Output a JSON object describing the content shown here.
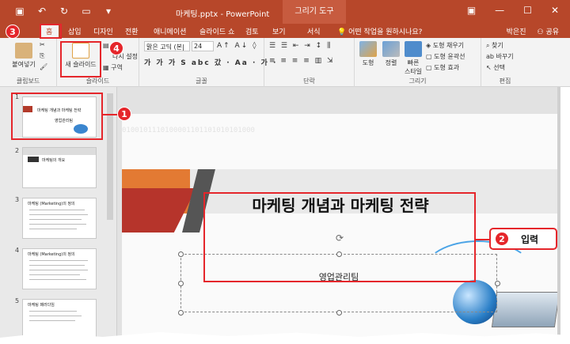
{
  "titlebar": {
    "doc_title": "마케팅.pptx - PowerPoint",
    "drawing_tools": "그리기 도구"
  },
  "tabs": [
    "홈",
    "삽입",
    "디자인",
    "전환",
    "애니메이션",
    "슬라이드 쇼",
    "검토",
    "보기",
    "서식"
  ],
  "tell_me": "어떤 작업을 원하시나요?",
  "user": {
    "name": "박은진",
    "share": "공유"
  },
  "ribbon": {
    "paste": "붙여넣기",
    "new_slide": "새 슬라이드",
    "layout_partial": "다시 설정",
    "section": "구역",
    "font_name": "맑은 고딕 (본|",
    "font_size": "24",
    "shape": "도형",
    "arrange": "정렬",
    "quick_styles": "빠른\n스타일",
    "shape_fill": "도형 채우기",
    "shape_outline": "도형 윤곽선",
    "shape_effects": "도형 효과",
    "find": "찾기",
    "replace": "바꾸기",
    "select": "선택",
    "groups": {
      "clipboard": "클립보드",
      "slides": "슬라이드",
      "font": "글꼴",
      "paragraph": "단락",
      "drawing": "그리기",
      "editing": "편집"
    }
  },
  "thumbnails": [
    {
      "num": "1",
      "title": "마케팅 개념과 마케팅 전략",
      "sub": "영업관리팀"
    },
    {
      "num": "2",
      "title": "마케팅의 개요"
    },
    {
      "num": "3",
      "title": "마케팅 (Marketing)의 정의"
    },
    {
      "num": "4",
      "title": "마케팅 (Marketing)의 정의"
    },
    {
      "num": "5",
      "title": "마케팅 패러다임"
    }
  ],
  "slide": {
    "binary": "0100101110100001101101010101000",
    "title": "마케팅 개념과 마케팅 전략",
    "subtitle": "영업관리팀"
  },
  "annotations": {
    "badge1": "1",
    "badge2": "2",
    "badge3": "3",
    "badge4": "4",
    "callout_label": "입력"
  },
  "colors": {
    "accent": "#b7472a",
    "annotation": "#e5262b"
  }
}
